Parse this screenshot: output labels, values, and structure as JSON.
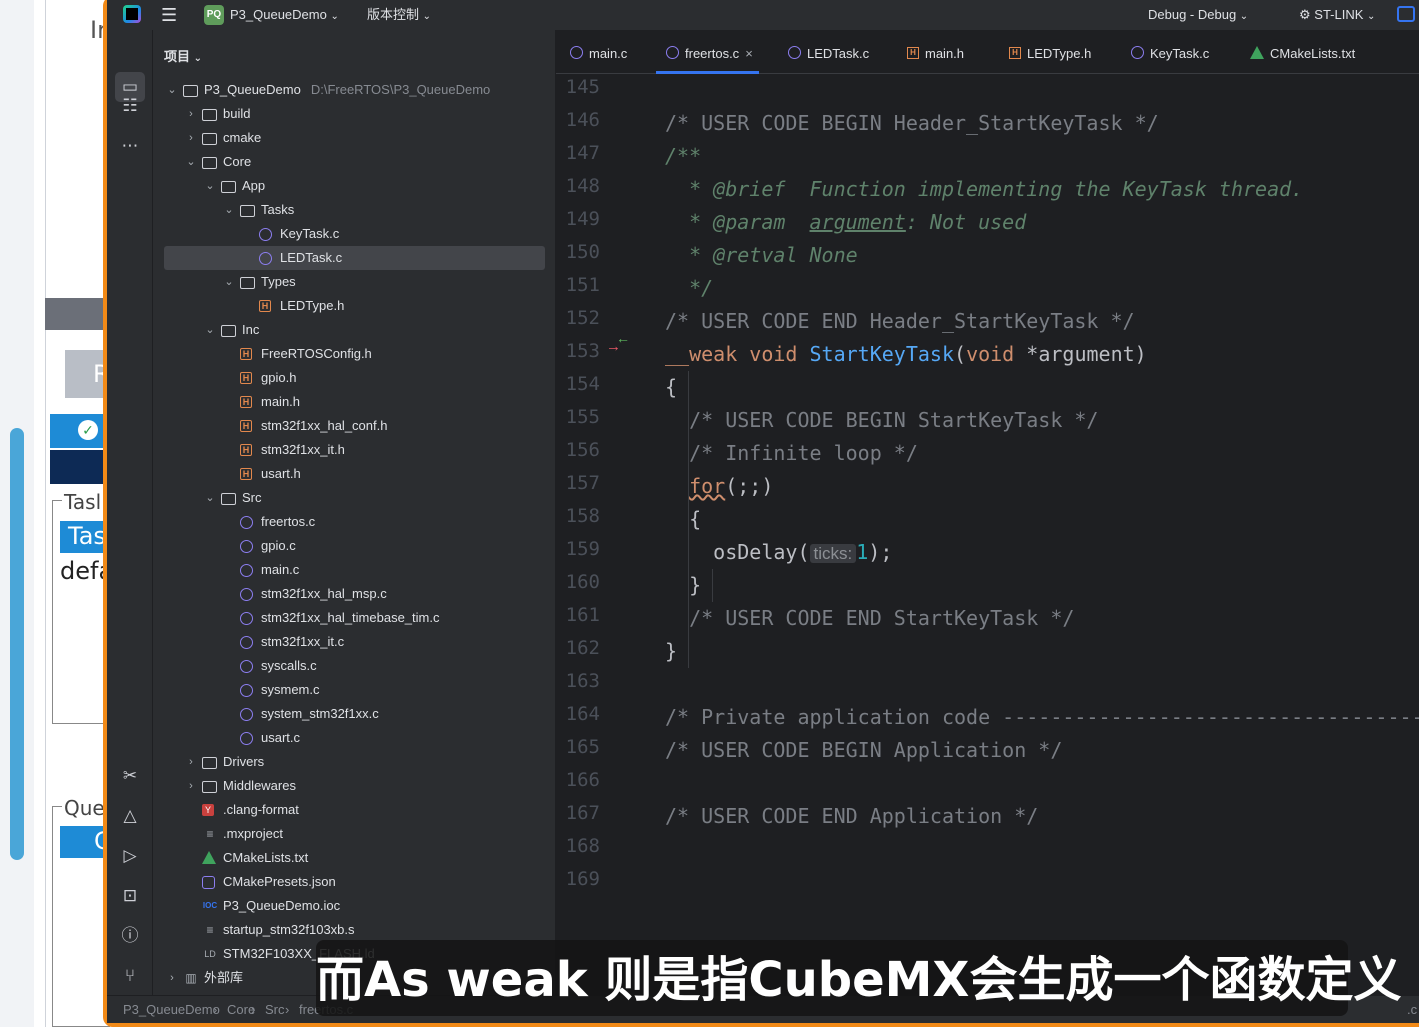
{
  "background_app": {
    "fragments": [
      "Ir",
      "Tasl",
      "Tas",
      "defa",
      "Que",
      "R",
      "C"
    ]
  },
  "titlebar": {
    "project": "P3_QueueDemo",
    "project_badge": "PQ",
    "vcs": "版本控制",
    "run_config": "Debug - Debug",
    "device": "ST-LINK"
  },
  "project_panel": {
    "title": "项目",
    "tree": [
      {
        "label": "P3_QueueDemo",
        "path": "D:\\FreeRTOS\\P3_QueueDemo",
        "level": 0,
        "icon": "folder",
        "chevron": "down"
      },
      {
        "label": "build",
        "level": 1,
        "icon": "folder",
        "chevron": "right"
      },
      {
        "label": "cmake",
        "level": 1,
        "icon": "folder",
        "chevron": "right"
      },
      {
        "label": "Core",
        "level": 1,
        "icon": "folder",
        "chevron": "down"
      },
      {
        "label": "App",
        "level": 2,
        "icon": "folder",
        "chevron": "down"
      },
      {
        "label": "Tasks",
        "level": 3,
        "icon": "folder",
        "chevron": "down"
      },
      {
        "label": "KeyTask.c",
        "level": 4,
        "icon": "cfile"
      },
      {
        "label": "LEDTask.c",
        "level": 4,
        "icon": "cfile",
        "selected": true
      },
      {
        "label": "Types",
        "level": 3,
        "icon": "folder",
        "chevron": "down"
      },
      {
        "label": "LEDType.h",
        "level": 4,
        "icon": "hfile"
      },
      {
        "label": "Inc",
        "level": 2,
        "icon": "folder",
        "chevron": "down"
      },
      {
        "label": "FreeRTOSConfig.h",
        "level": 3,
        "icon": "hfile"
      },
      {
        "label": "gpio.h",
        "level": 3,
        "icon": "hfile"
      },
      {
        "label": "main.h",
        "level": 3,
        "icon": "hfile"
      },
      {
        "label": "stm32f1xx_hal_conf.h",
        "level": 3,
        "icon": "hfile"
      },
      {
        "label": "stm32f1xx_it.h",
        "level": 3,
        "icon": "hfile"
      },
      {
        "label": "usart.h",
        "level": 3,
        "icon": "hfile"
      },
      {
        "label": "Src",
        "level": 2,
        "icon": "folder",
        "chevron": "down"
      },
      {
        "label": "freertos.c",
        "level": 3,
        "icon": "cfile"
      },
      {
        "label": "gpio.c",
        "level": 3,
        "icon": "cfile"
      },
      {
        "label": "main.c",
        "level": 3,
        "icon": "cfile"
      },
      {
        "label": "stm32f1xx_hal_msp.c",
        "level": 3,
        "icon": "cfile"
      },
      {
        "label": "stm32f1xx_hal_timebase_tim.c",
        "level": 3,
        "icon": "cfile"
      },
      {
        "label": "stm32f1xx_it.c",
        "level": 3,
        "icon": "cfile"
      },
      {
        "label": "syscalls.c",
        "level": 3,
        "icon": "cfile"
      },
      {
        "label": "sysmem.c",
        "level": 3,
        "icon": "cfile"
      },
      {
        "label": "system_stm32f1xx.c",
        "level": 3,
        "icon": "cfile"
      },
      {
        "label": "usart.c",
        "level": 3,
        "icon": "cfile"
      },
      {
        "label": "Drivers",
        "level": 1,
        "icon": "folder",
        "chevron": "right"
      },
      {
        "label": "Middlewares",
        "level": 1,
        "icon": "folder",
        "chevron": "right"
      },
      {
        "label": ".clang-format",
        "level": 1,
        "icon": "clang"
      },
      {
        "label": ".mxproject",
        "level": 1,
        "icon": "text"
      },
      {
        "label": "CMakeLists.txt",
        "level": 1,
        "icon": "cmake"
      },
      {
        "label": "CMakePresets.json",
        "level": 1,
        "icon": "json"
      },
      {
        "label": "P3_QueueDemo.ioc",
        "level": 1,
        "icon": "ioc"
      },
      {
        "label": "startup_stm32f103xb.s",
        "level": 1,
        "icon": "text"
      },
      {
        "label": "STM32F103XX_FLASH.ld",
        "level": 1,
        "icon": "ld"
      },
      {
        "label": "外部库",
        "level": 0,
        "icon": "library",
        "chevron": "right"
      }
    ]
  },
  "tabs": [
    {
      "label": "main.c",
      "icon": "c"
    },
    {
      "label": "freertos.c",
      "icon": "c",
      "active": true,
      "closable": true
    },
    {
      "label": "LEDTask.c",
      "icon": "c"
    },
    {
      "label": "main.h",
      "icon": "h"
    },
    {
      "label": "LEDType.h",
      "icon": "h"
    },
    {
      "label": "KeyTask.c",
      "icon": "c"
    },
    {
      "label": "CMakeLists.txt",
      "icon": "cm"
    }
  ],
  "editor": {
    "line_numbers": [
      "145",
      "146",
      "147",
      "148",
      "149",
      "150",
      "151",
      "152",
      "153",
      "154",
      "155",
      "156",
      "157",
      "158",
      "159",
      "160",
      "161",
      "162",
      "163",
      "164",
      "165",
      "166",
      "167",
      "168",
      "169"
    ],
    "lines": [
      {
        "text": ""
      },
      {
        "text": "/* USER CODE BEGIN Header_StartKeyTask */"
      },
      {
        "text": "/**"
      },
      {
        "text": "  * @brief  Function implementing the KeyTask thread."
      },
      {
        "text": "  * @param  argument: Not used"
      },
      {
        "text": "  * @retval None"
      },
      {
        "text": "  */"
      },
      {
        "text": "/* USER CODE END Header_StartKeyTask */"
      },
      {
        "text": "__weak void StartKeyTask(void *argument)"
      },
      {
        "text": "{"
      },
      {
        "text": "  /* USER CODE BEGIN StartKeyTask */"
      },
      {
        "text": "  /* Infinite loop */"
      },
      {
        "text": "  for(;;)"
      },
      {
        "text": "  {"
      },
      {
        "text": "    osDelay( ticks: 1);"
      },
      {
        "text": "  }"
      },
      {
        "text": "  /* USER CODE END StartKeyTask */"
      },
      {
        "text": "}"
      },
      {
        "text": ""
      },
      {
        "text": "/* Private application code --------------------------------------------------*/"
      },
      {
        "text": "/* USER CODE BEGIN Application */"
      },
      {
        "text": ""
      },
      {
        "text": "/* USER CODE END Application */"
      },
      {
        "text": ""
      },
      {
        "text": ""
      }
    ],
    "tokens": {
      "header_begin": "/* USER CODE BEGIN Header_StartKeyTask */",
      "doc_open": "/**",
      "brief_star": "  * ",
      "brief_tag": "@brief",
      "brief_text": "  Function implementing the KeyTask thread.",
      "param_star": "  * ",
      "param_tag": "@param",
      "param_gap": "  ",
      "param_name": "argument",
      "param_text": ": Not used",
      "retval_star": "  * ",
      "retval_tag": "@retval",
      "retval_text": " None",
      "doc_close": "  */",
      "header_end": "/* USER CODE END Header_StartKeyTask */",
      "weak": "__weak",
      "void1": "void",
      "fname": "StartKeyTask",
      "paren_open": "(",
      "void2": "void",
      "arg": " *argument)",
      "brace_open": "{",
      "task_begin": "  /* USER CODE BEGIN StartKeyTask */",
      "infinite": "  /* Infinite loop */",
      "for_kw": "for",
      "for_rest": "(;;)",
      "inner_open": "  {",
      "os_delay": "    osDelay(",
      "ticks_hint": "ticks:",
      "ticks_val": "1",
      "os_delay_end": ");",
      "inner_close": "  }",
      "task_end": "  /* USER CODE END StartKeyTask */",
      "brace_close": "}",
      "private_code": "/* Private application code --------------------------------------------------*/",
      "app_begin": "/* USER CODE BEGIN Application */",
      "app_end": "/* USER CODE END Application */"
    }
  },
  "statusbar": {
    "crumbs": [
      "P3_QueueDemo",
      "Core",
      "Src",
      "freertos.c"
    ],
    "right": ".c"
  },
  "subtitle": "而As weak 则是指CubeMX会生成一个函数定义",
  "colors": {
    "frame_orange": "#f28a17",
    "accent_blue": "#3574f0",
    "keyword": "#cf8e6d",
    "function": "#56a8f5",
    "comment": "#7a7e85",
    "doc_comment": "#5f826b"
  }
}
